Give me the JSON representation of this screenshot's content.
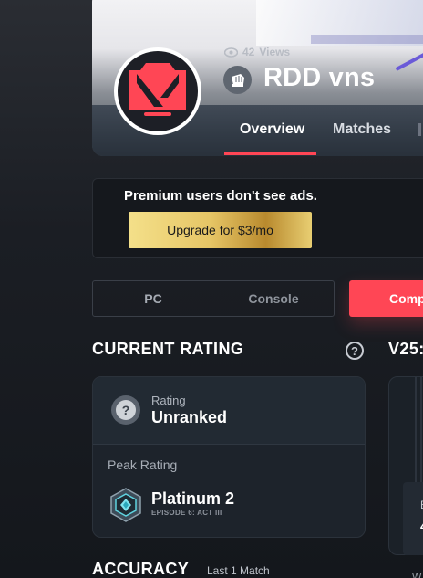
{
  "profile": {
    "views_count": "42",
    "views_label": "Views",
    "player_name": "RDD vns",
    "tabs": [
      {
        "label": "Overview",
        "active": true
      },
      {
        "label": "Matches",
        "active": false
      }
    ]
  },
  "ad": {
    "message": "Premium users don't see ads.",
    "upgrade_label": "Upgrade for $3/mo"
  },
  "platform": {
    "options": [
      "PC",
      "Console"
    ],
    "mode_label": "Comp"
  },
  "current_rating": {
    "section_title": "CURRENT RATING",
    "help_glyph": "?",
    "rating_label": "Rating",
    "rating_value": "Unranked",
    "peak_label": "Peak Rating",
    "peak_value": "Platinum 2",
    "peak_episode": "EPISODE 6: ACT III"
  },
  "season": {
    "title_fragment": "V25:",
    "text_fragment_1": "E",
    "text_fragment_2": "4",
    "text_fragment_3": "W"
  },
  "accuracy": {
    "title": "ACCURACY",
    "subtitle": "Last 1 Match"
  },
  "colors": {
    "accent": "#ff4655",
    "card": "#1d232b",
    "page": "#14171c"
  }
}
